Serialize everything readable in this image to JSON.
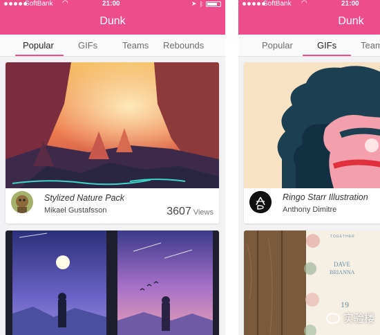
{
  "status_bar": {
    "carrier": "SoftBank",
    "time": "21:00"
  },
  "app": {
    "title": "Dunk"
  },
  "left_screen": {
    "tabs": [
      "Popular",
      "GIFs",
      "Teams",
      "Rebounds"
    ],
    "active_tab": "Popular",
    "card": {
      "title": "Stylized Nature Pack",
      "author": "Mikael Gustafsson",
      "views_count": "3607",
      "views_label": "Views"
    }
  },
  "right_screen": {
    "tabs": [
      "Popular",
      "GIFs",
      "Team"
    ],
    "active_tab": "GIFs",
    "card": {
      "title": "Ringo Starr Illustration",
      "author": "Anthony Dimitre"
    }
  },
  "wedding_card": {
    "line1": "TOGETHER",
    "names_1": "DAVE",
    "names_2": "BRIANNA",
    "date_day": "19"
  },
  "watermark": {
    "text": "实验楼"
  },
  "colors": {
    "accent": "#ee4d8c",
    "tab_text": "#6d6d72",
    "active_tab_text": "#222222"
  }
}
